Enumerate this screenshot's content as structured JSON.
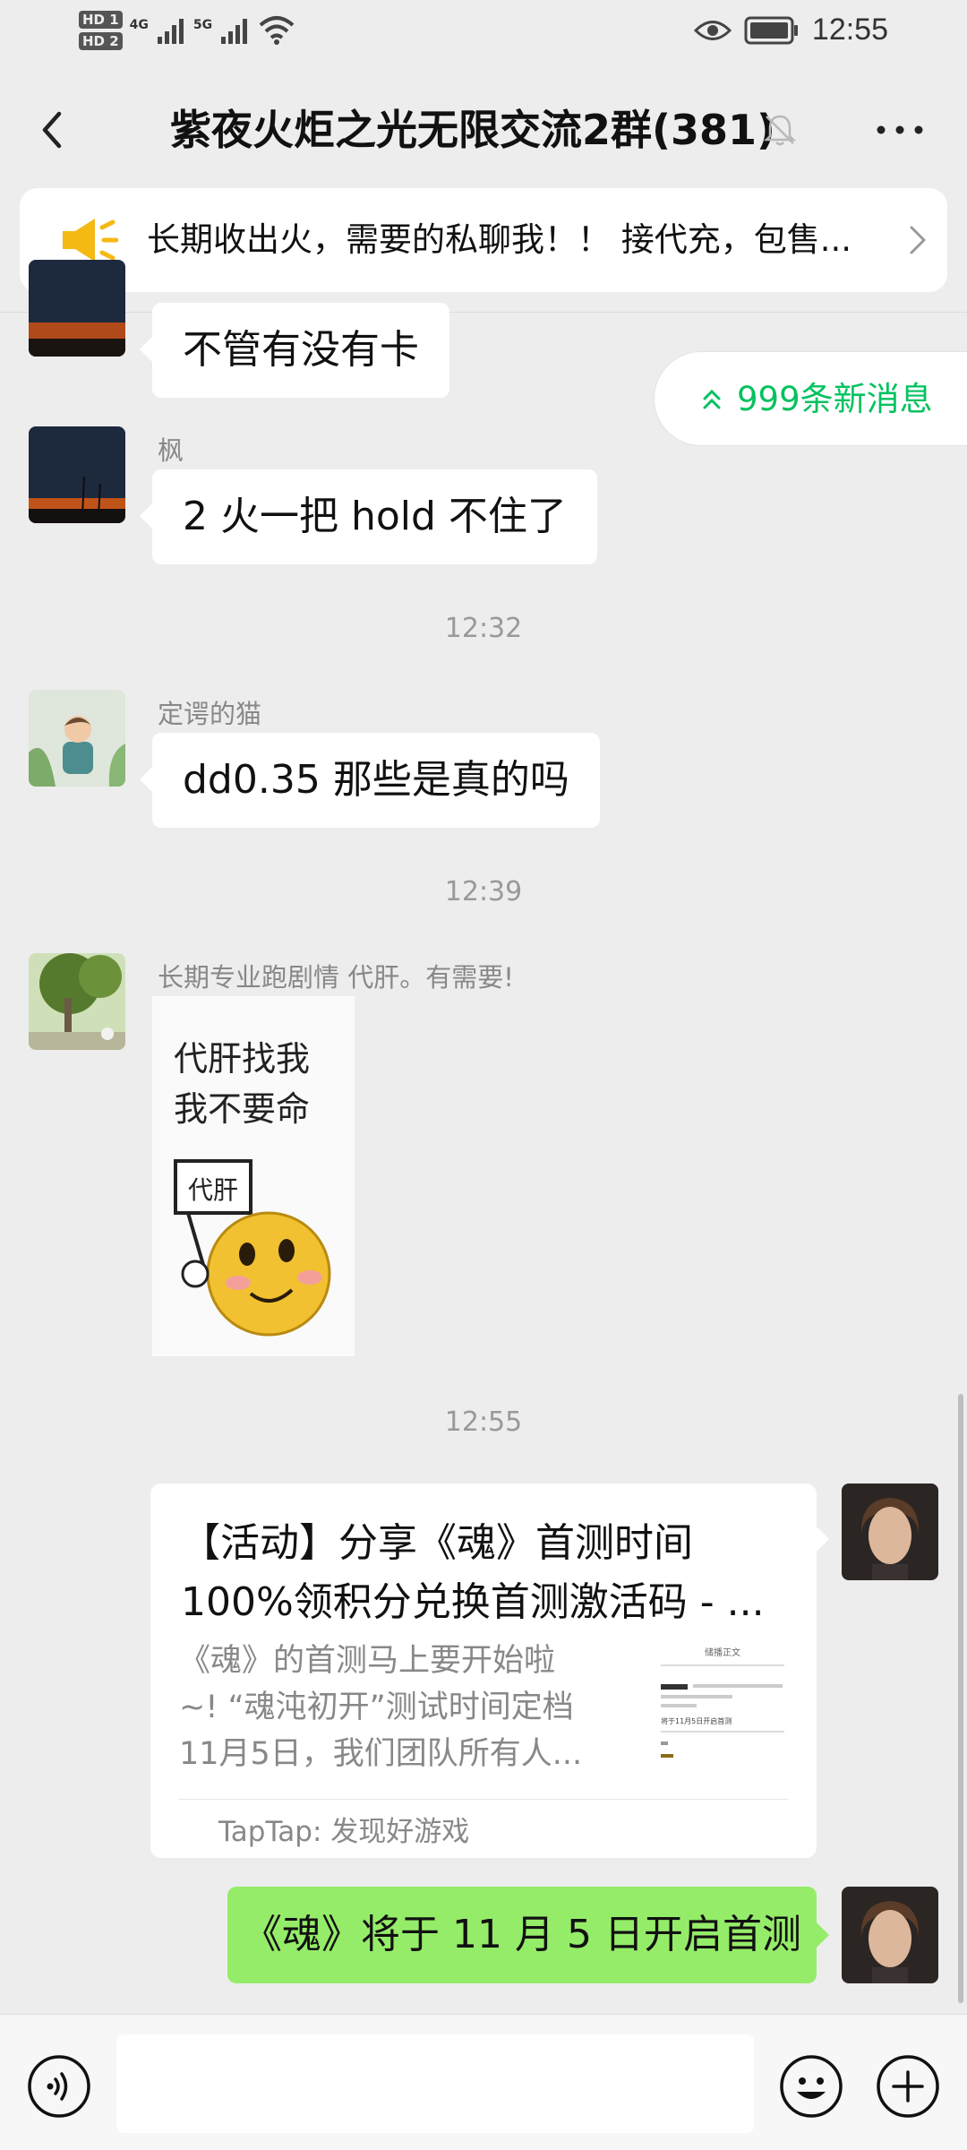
{
  "status_bar": {
    "hd1": "HD 1",
    "hd2": "HD 2",
    "net1": "4G",
    "net2": "5G",
    "time": "12:55"
  },
  "header": {
    "title": "紫夜火炬之光无限交流2群(381)",
    "back_icon": "chevron-left-icon",
    "mute_icon": "bell-off-icon",
    "more_icon": "more-icon"
  },
  "announcement": {
    "text": "长期收出火，需要的私聊我！！ 接代充，包售...",
    "icon": "megaphone-icon",
    "color": "#f5b914"
  },
  "new_messages": {
    "label": "999条新消息",
    "color": "#07c160"
  },
  "messages": [
    {
      "sender": "",
      "text": "不管有没有卡"
    },
    {
      "sender": "枫",
      "text": "2 火一把 hold 不住了"
    },
    {
      "time": "12:32"
    },
    {
      "sender": "定谔的猫",
      "text": "dd0.35 那些是真的吗"
    },
    {
      "time": "12:39"
    },
    {
      "sender": "长期专业跑剧情 代肝。有需要!",
      "sticker_lines": [
        "代肝找我",
        "我不要命"
      ],
      "sticker_sign": "代肝"
    },
    {
      "time": "12:55"
    }
  ],
  "link_card": {
    "title_line1": "【活动】分享《魂》首测时间",
    "title_line2": "100%领积分兑换首测激活码 - ...",
    "desc_line1": "《魂》的首测马上要开始啦",
    "desc_line2": "~! “魂沌初开”测试时间定档",
    "desc_line3": "11月5日，我们团队所有人...",
    "source": "TapTap: 发现好游戏",
    "thumb_heading": "储播正文",
    "thumb_snippet": "将于11月5日开启首测"
  },
  "my_message": {
    "text": "《魂》将于 11 月 5 日开启首测",
    "color": "#95ec69"
  },
  "input_bar": {
    "voice_icon": "voice-icon",
    "emoji_icon": "emoji-icon",
    "plus_icon": "plus-icon"
  }
}
